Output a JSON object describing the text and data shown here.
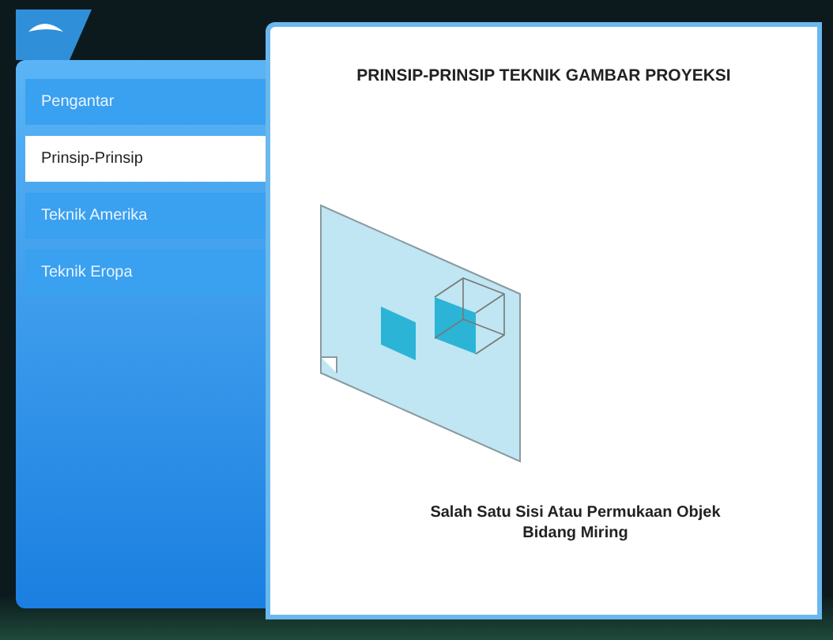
{
  "sidebar": {
    "items": [
      {
        "label": "Pengantar",
        "selected": false
      },
      {
        "label": "Prinsip-Prinsip",
        "selected": true
      },
      {
        "label": "Teknik Amerika",
        "selected": false
      },
      {
        "label": "Teknik Eropa",
        "selected": false
      }
    ]
  },
  "content": {
    "title": "PRINSIP-PRINSIP TEKNIK GAMBAR PROYEKSI",
    "caption": "Salah Satu Sisi Atau Permukaan Objek Bidang Miring"
  }
}
